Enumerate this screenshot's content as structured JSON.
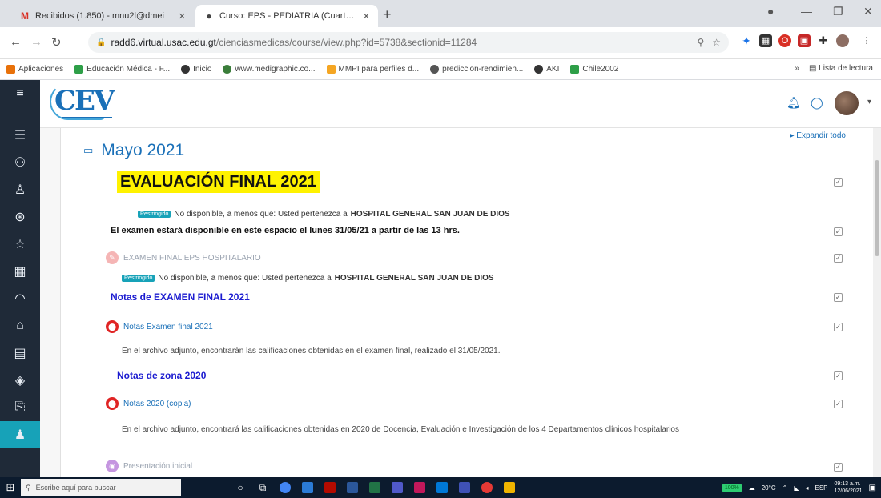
{
  "browser": {
    "tabs": [
      {
        "title": "Recibidos (1.850) - mnu2l@dmei",
        "icon": "gmail-icon",
        "active": false
      },
      {
        "title": "Curso: EPS - PEDIATRIA (Cuarto Re",
        "icon": "moodle-icon",
        "active": true
      }
    ],
    "new_tab": "+",
    "url_host": "radd6.virtual.usac.edu.gt",
    "url_path": "/cienciasmedicas/course/view.php?id=5738&sectionid=11284",
    "bookmarks": [
      {
        "label": "Aplicaciones",
        "color": "#5f6368"
      },
      {
        "label": "Educación Médica - F...",
        "color": "#2e9f48"
      },
      {
        "label": "Inicio",
        "color": "#333333"
      },
      {
        "label": "www.medigraphic.co...",
        "color": "#3a7d3a"
      },
      {
        "label": "MMPI para perfiles d...",
        "color": "#f5a623"
      },
      {
        "label": "prediccion-rendimien...",
        "color": "#555555"
      },
      {
        "label": "AKI",
        "color": "#333333"
      },
      {
        "label": "Chile2002",
        "color": "#2e9f48"
      }
    ],
    "reading_list": "Lista de lectura"
  },
  "header": {
    "logo_text": "CEV",
    "expand_all": "▸ Expandir todo"
  },
  "section": {
    "title": "Mayo 2021",
    "eval_title": "EVALUACIÓN FINAL 2021",
    "restricted_badge": "Restringido",
    "restricted_text": "No disponible, a menos que: Usted pertenezca a",
    "restricted_group": "HOSPITAL GENERAL SAN JUAN DE DIOS",
    "exam_notice": "El examen estará disponible en este espacio el lunes 31/05/21 a partir de las 13 hrs.",
    "exam_activity": "EXAMEN FINAL EPS HOSPITALARIO",
    "notas_exam_heading": "Notas de EXAMEN FINAL 2021",
    "notas_exam_file": "Notas Examen final 2021",
    "notas_exam_desc": "En el archivo adjunto, encontrarán las calificaciones obtenidas en el examen final, realizado el 31/05/2021.",
    "notas_zona_heading": "Notas de zona 2020",
    "notas_zona_file": "Notas 2020 (copia)",
    "notas_zona_desc": "En el archivo adjunto, encontrará las calificaciones obtenidas en 2020 de Docencia, Evaluación e Investigación de los 4 Departamentos clínicos hospitalarios",
    "presentacion": "Presentación inicial"
  },
  "taskbar": {
    "search_placeholder": "Escribe aquí para buscar",
    "battery": "100%",
    "temperature": "20°C",
    "lang": "ESP",
    "time": "09:13 a.m.",
    "date": "12/06/2021"
  },
  "colors": {
    "accent": "#1a70b8",
    "drawer": "#1f2a38",
    "highlight": "#fff200",
    "pdf_red": "#e02424"
  }
}
